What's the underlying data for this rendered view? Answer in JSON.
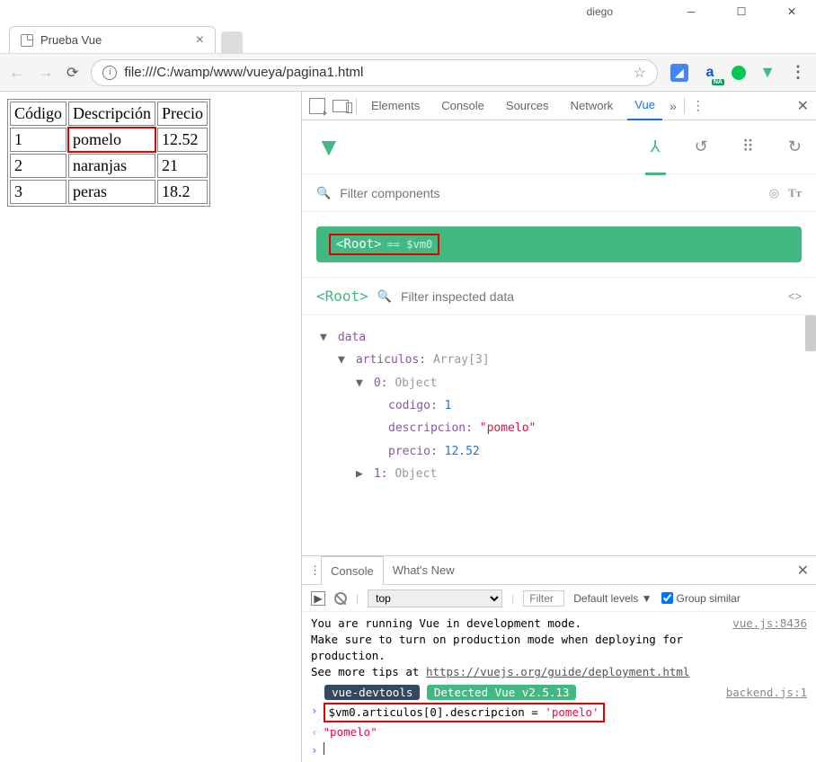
{
  "window": {
    "user": "diego"
  },
  "browser_tab": {
    "title": "Prueba Vue"
  },
  "omnibox": {
    "url": "file:///C:/wamp/www/vueya/pagina1.html"
  },
  "ext_badge": "NA",
  "page_table": {
    "headers": [
      "Código",
      "Descripción",
      "Precio"
    ],
    "rows": [
      {
        "codigo": "1",
        "descripcion": "pomelo",
        "precio": "12.52"
      },
      {
        "codigo": "2",
        "descripcion": "naranjas",
        "precio": "21"
      },
      {
        "codigo": "3",
        "descripcion": "peras",
        "precio": "18.2"
      }
    ]
  },
  "devtools": {
    "tabs": [
      "Elements",
      "Console",
      "Sources",
      "Network",
      "Vue"
    ]
  },
  "vue_panel": {
    "filter_components_placeholder": "Filter components",
    "root_label": "<Root>",
    "vm_badge": "== $vm0",
    "inspect_root": "<Root>",
    "filter_data_placeholder": "Filter inspected data",
    "data_label": "data",
    "articulos_label": "articulos:",
    "articulos_type": "Array[3]",
    "idx0_label": "0:",
    "idx0_type": "Object",
    "codigo_key": "codigo:",
    "codigo_val": "1",
    "descripcion_key": "descripcion:",
    "descripcion_val": "\"pomelo\"",
    "precio_key": "precio:",
    "precio_val": "12.52",
    "idx1_label": "1:",
    "idx1_type": "Object"
  },
  "console_drawer": {
    "tabs": [
      "Console",
      "What's New"
    ],
    "context": "top",
    "filter_placeholder": "Filter",
    "levels": "Default levels ▼",
    "group_similar": "Group similar",
    "msg1": "You are running Vue in development mode.\nMake sure to turn on production mode when deploying for production.\nSee more tips at ",
    "msg1_link": "https://vuejs.org/guide/deployment.html",
    "msg1_src": "vue.js:8436",
    "badge_vdev": "vue-devtools",
    "badge_detected": "Detected Vue v2.5.13",
    "msg2_src": "backend.js:1",
    "input_code_a": "$vm0.articulos[0].descripcion = ",
    "input_code_b": "'pomelo'",
    "output_val": "\"pomelo\""
  }
}
